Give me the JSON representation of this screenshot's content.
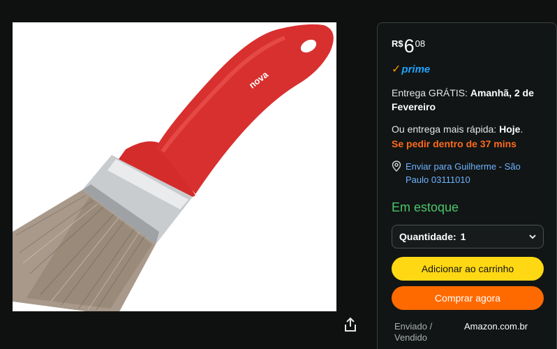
{
  "product": {
    "image_alt": "Pincel com cabo vermelho",
    "brand_logo_text": "nova"
  },
  "price": {
    "currency": "R$",
    "whole": "6",
    "fraction": "08"
  },
  "prime": {
    "label": "prime",
    "check_color": "#ff9900",
    "text_color": "#1fa3ff"
  },
  "delivery": {
    "prefix": "Entrega GRÁTIS: ",
    "date": "Amanhã, 2 de Fevereiro"
  },
  "fast_delivery": {
    "prefix": "Ou entrega mais rápida: ",
    "when": "Hoje",
    "suffix": ".",
    "cutoff": "Se pedir dentro de 37 mins"
  },
  "address": {
    "text": "Enviar para Guilherme - São Paulo 03111010"
  },
  "stock": {
    "text": "Em estoque"
  },
  "quantity": {
    "label": "Quantidade:",
    "value": "1"
  },
  "buttons": {
    "add_to_cart": "Adicionar ao carrinho",
    "buy_now": "Comprar agora"
  },
  "seller": {
    "label": "Enviado / Vendido",
    "value": "Amazon.com.br"
  },
  "icons": {
    "share": "share-icon",
    "location": "location-pin-icon",
    "chevron": "chevron-down-icon"
  }
}
